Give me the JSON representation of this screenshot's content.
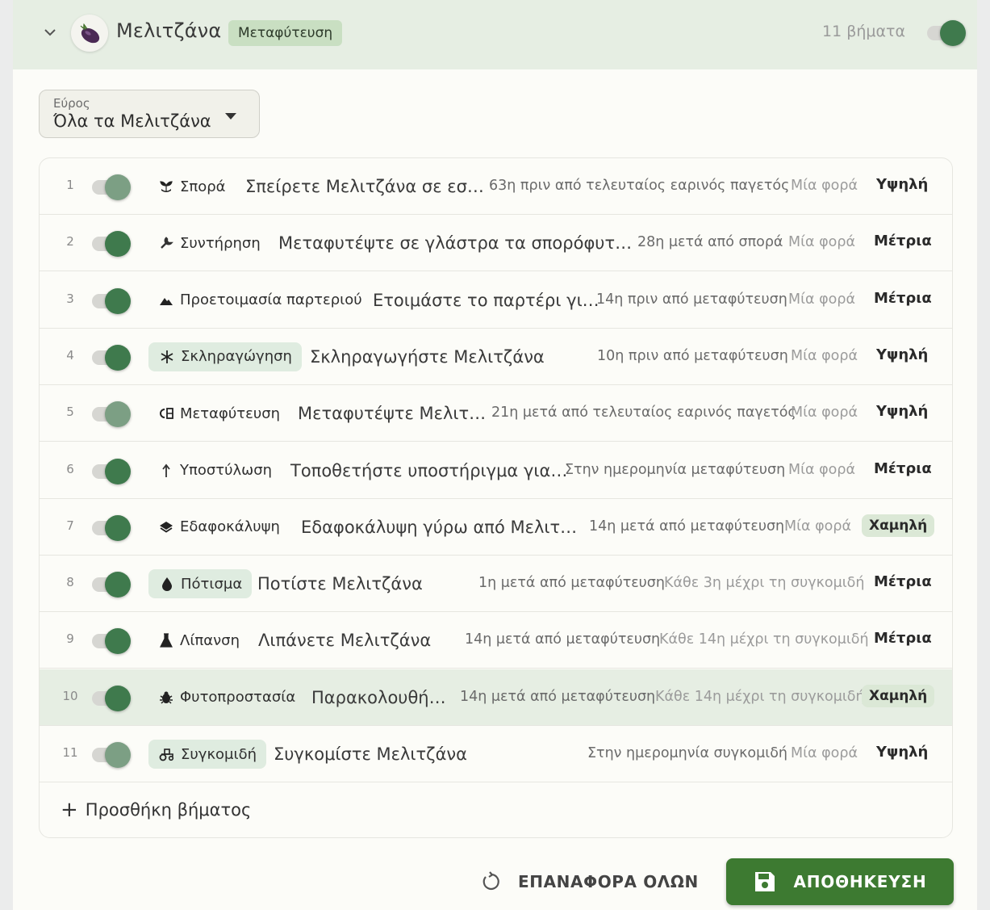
{
  "header": {
    "crop_name": "Μελιτζάνα",
    "crop_icon": "eggplant-icon",
    "method_chip": "Μεταφύτευση",
    "steps_count": "11 βήματα",
    "enabled": true
  },
  "scope": {
    "label": "Εύρος",
    "value": "Όλα τα Μελιτζάνα"
  },
  "steps": [
    {
      "num": "1",
      "enabled": true,
      "category": "Σπορά",
      "icon": "seedling-icon",
      "title": "Σπείρετε Μελιτζάνα σε εσ…",
      "timing": "63η πριν από τελευταίος εαρινός παγετός",
      "frequency": "Μία φορά",
      "priority": "Υψηλή"
    },
    {
      "num": "2",
      "enabled": true,
      "category": "Συντήρηση",
      "icon": "wrench-icon",
      "title": "Μεταφυτέψτε σε γλάστρα τα σπορόφυτ…",
      "timing": "28η μετά από σπορά",
      "frequency": "Μία φορά",
      "priority": "Μέτρια"
    },
    {
      "num": "3",
      "enabled": true,
      "category": "Προετοιμασία παρτεριού",
      "icon": "terrain-icon",
      "title": "Ετοιμάστε το παρτέρι γι…",
      "timing": "14η πριν από μεταφύτευση",
      "frequency": "Μία φορά",
      "priority": "Μέτρια"
    },
    {
      "num": "4",
      "enabled": true,
      "category": "Σκληραγώγηση",
      "icon": "snowflake-icon",
      "title": "Σκληραγωγήστε Μελιτζάνα",
      "timing": "10η πριν από μεταφύτευση",
      "frequency": "Μία φορά",
      "priority": "Υψηλή"
    },
    {
      "num": "5",
      "enabled": true,
      "category": "Μεταφύτευση",
      "icon": "transplant-icon",
      "title": "Μεταφυτέψτε Μελιτ…",
      "timing": "21η μετά από τελευταίος εαρινός παγετός",
      "frequency": "Μία φορά",
      "priority": "Υψηλή"
    },
    {
      "num": "6",
      "enabled": true,
      "category": "Υποστύλωση",
      "icon": "arrow-up-icon",
      "title": "Τοποθετήστε υποστήριγμα για…",
      "timing": "Στην ημερομηνία μεταφύτευση",
      "frequency": "Μία φορά",
      "priority": "Μέτρια"
    },
    {
      "num": "7",
      "enabled": true,
      "category": "Εδαφοκάλυψη",
      "icon": "layers-icon",
      "title": "Εδαφοκάλυψη γύρω από Μελιτ…",
      "timing": "14η μετά από μεταφύτευση",
      "frequency": "Μία φορά",
      "priority": "Χαμηλή"
    },
    {
      "num": "8",
      "enabled": true,
      "category": "Πότισμα",
      "icon": "water-drop-icon",
      "title": "Ποτίστε Μελιτζάνα",
      "timing": "1η μετά από μεταφύτευση",
      "frequency": "Κάθε 3η μέχρι τη συγκομιδή",
      "priority": "Μέτρια"
    },
    {
      "num": "9",
      "enabled": true,
      "category": "Λίπανση",
      "icon": "flask-icon",
      "title": "Λιπάνετε Μελιτζάνα",
      "timing": "14η μετά από μεταφύτευση",
      "frequency": "Κάθε 14η μέχρι τη συγκομιδή",
      "priority": "Μέτρια"
    },
    {
      "num": "10",
      "enabled": true,
      "category": "Φυτοπροστασία",
      "icon": "bug-icon",
      "title": "Παρακολουθή…",
      "timing": "14η μετά από μεταφύτευση",
      "frequency": "Κάθε 14η μέχρι τη συγκομιδή",
      "priority": "Χαμηλή"
    },
    {
      "num": "11",
      "enabled": true,
      "category": "Συγκομιδή",
      "icon": "tractor-icon",
      "title": "Συγκομίστε Μελιτζάνα",
      "timing": "Στην ημερομηνία συγκομιδή",
      "frequency": "Μία φορά",
      "priority": "Υψηλή"
    }
  ],
  "add_step_label": "Προσθήκη βήματος",
  "footer": {
    "reset_label": "ΕΠΑΝΑΦΟΡΑ ΟΛΩΝ",
    "save_label": "ΑΠΟΘΗΚΕΥΣΗ"
  },
  "colors": {
    "accent": "#3f7a4d",
    "save_button": "#3d7a31",
    "header_bg": "#e6eee3",
    "chip_bg": "#c9dfc2"
  }
}
